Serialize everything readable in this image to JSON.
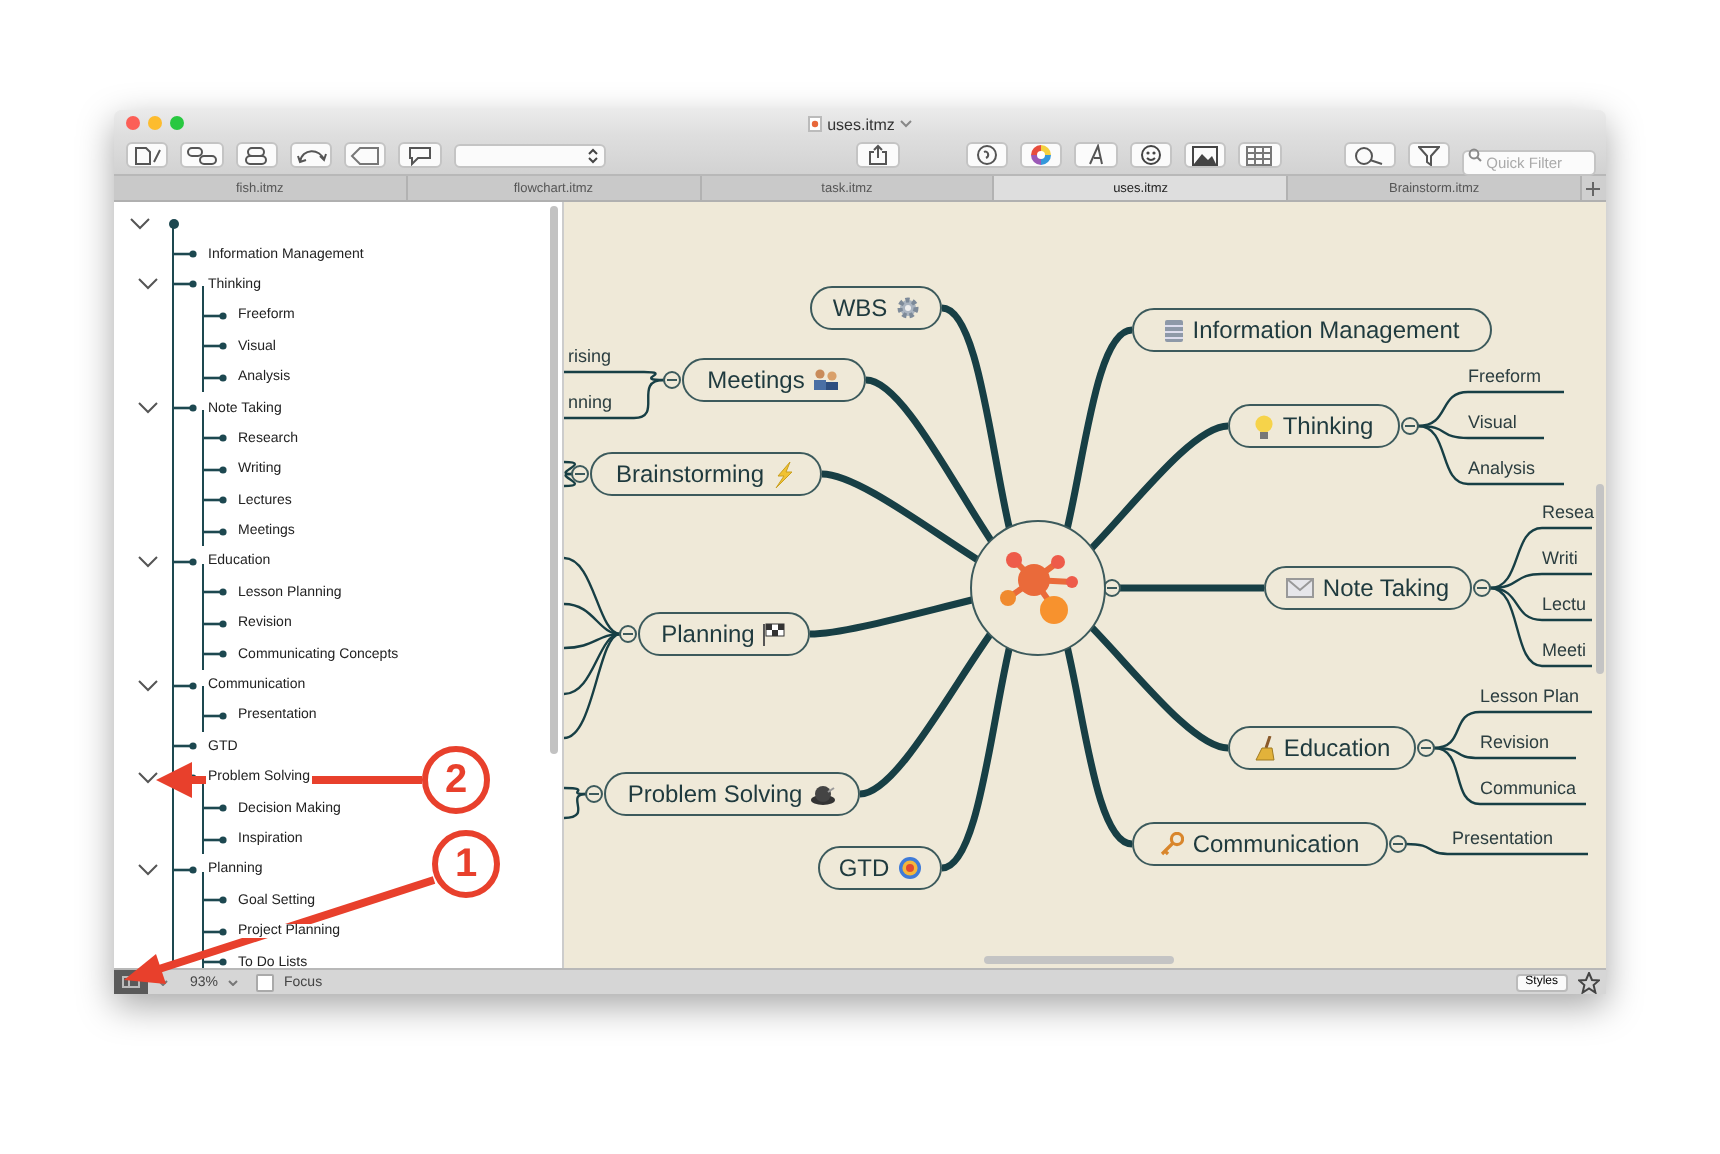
{
  "window": {
    "title": "uses.itmz"
  },
  "toolbar": {
    "search": {
      "placeholder": "Quick Filter"
    }
  },
  "tabs": [
    {
      "label": "fish.itmz",
      "selected": false
    },
    {
      "label": "flowchart.itmz",
      "selected": false
    },
    {
      "label": "task.itmz",
      "selected": false
    },
    {
      "label": "uses.itmz",
      "selected": true
    },
    {
      "label": "Brainstorm.itmz",
      "selected": false
    }
  ],
  "outline": {
    "root": {
      "expanded": true
    },
    "items": [
      {
        "label": "Information Management"
      },
      {
        "label": "Thinking",
        "expanded": true,
        "children": [
          {
            "label": "Freeform"
          },
          {
            "label": "Visual"
          },
          {
            "label": "Analysis"
          }
        ]
      },
      {
        "label": "Note Taking",
        "expanded": true,
        "children": [
          {
            "label": "Research"
          },
          {
            "label": "Writing"
          },
          {
            "label": "Lectures"
          },
          {
            "label": "Meetings"
          }
        ]
      },
      {
        "label": "Education",
        "expanded": true,
        "children": [
          {
            "label": "Lesson Planning"
          },
          {
            "label": "Revision"
          },
          {
            "label": "Communicating Concepts"
          }
        ]
      },
      {
        "label": "Communication",
        "expanded": true,
        "children": [
          {
            "label": "Presentation"
          }
        ]
      },
      {
        "label": "GTD"
      },
      {
        "label": "Problem Solving",
        "expanded": true,
        "children": [
          {
            "label": "Decision Making"
          },
          {
            "label": "Inspiration"
          }
        ]
      },
      {
        "label": "Planning",
        "expanded": true,
        "children": [
          {
            "label": "Goal Setting"
          },
          {
            "label": "Project Planning"
          },
          {
            "label": "To Do Lists"
          }
        ]
      }
    ]
  },
  "map": {
    "central_topic": {
      "expanded": true
    },
    "nodes": [
      {
        "label": "WBS"
      },
      {
        "label": "Meetings",
        "expanded": true,
        "children": [
          {
            "label": "rising"
          },
          {
            "label": "nning"
          }
        ]
      },
      {
        "label": "Brainstorming",
        "expanded": true
      },
      {
        "label": "Planning",
        "expanded": true
      },
      {
        "label": "Problem Solving",
        "expanded": true
      },
      {
        "label": "GTD"
      },
      {
        "label": "Information Management"
      },
      {
        "label": "Thinking",
        "expanded": true,
        "children": [
          {
            "label": "Freeform"
          },
          {
            "label": "Visual"
          },
          {
            "label": "Analysis"
          }
        ]
      },
      {
        "label": "Note Taking",
        "expanded": true,
        "children": [
          {
            "label": "Resea"
          },
          {
            "label": "Writi"
          },
          {
            "label": "Lectu"
          },
          {
            "label": "Meeti"
          }
        ]
      },
      {
        "label": "Education",
        "expanded": true,
        "children": [
          {
            "label": "Lesson Plan"
          },
          {
            "label": "Revision"
          },
          {
            "label": "Communica"
          }
        ]
      },
      {
        "label": "Communication",
        "expanded": true,
        "children": [
          {
            "label": "Presentation"
          }
        ]
      }
    ]
  },
  "status_bar": {
    "zoom": "93%",
    "focus": {
      "label": "Focus",
      "checked": false
    },
    "styles_button": "Styles"
  },
  "annotations": [
    {
      "number": "2"
    },
    {
      "number": "1"
    }
  ]
}
